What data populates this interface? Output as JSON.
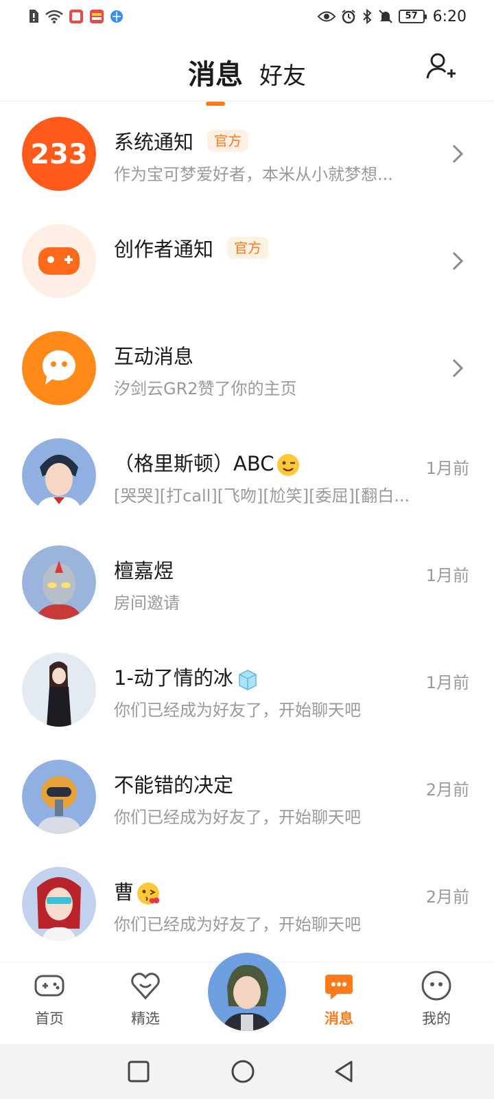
{
  "status_bar": {
    "time": "6:20",
    "battery": "57"
  },
  "header": {
    "tab_messages": "消息",
    "tab_friends": "好友"
  },
  "messages": [
    {
      "name": "系统通知",
      "badge": "官方",
      "preview": "作为宝可梦爱好者，本米从小就梦想...",
      "avatar": "233-logo"
    },
    {
      "name": "创作者通知",
      "badge": "官方",
      "preview": "",
      "avatar": "gamepad-avatar"
    },
    {
      "name": "互动消息",
      "preview": "汐剑云GR2赞了你的主页",
      "avatar": "chat-bubble-avatar"
    },
    {
      "name": "（格里斯顿）ABC",
      "time": "1月前",
      "preview": "[哭哭][打call][飞吻][尬笑][委屈][翻白...",
      "avatar": "user-avatar"
    },
    {
      "name": "檀嘉煜",
      "time": "1月前",
      "preview": "房间邀请",
      "avatar": "user-avatar"
    },
    {
      "name": "1-动了情的冰",
      "time": "1月前",
      "preview": "你们已经成为好友了，开始聊天吧",
      "avatar": "user-avatar"
    },
    {
      "name": "不能错的决定",
      "time": "2月前",
      "preview": "你们已经成为好友了，开始聊天吧",
      "avatar": "user-avatar"
    },
    {
      "name": "曹",
      "time": "2月前",
      "preview": "你们已经成为好友了，开始聊天吧",
      "avatar": "user-avatar"
    }
  ],
  "logo_text": "233",
  "bottom_nav": {
    "home": "首页",
    "featured": "精选",
    "messages": "消息",
    "mine": "我的"
  },
  "colors": {
    "accent": "#ff7a1a",
    "muted": "#9a9a9a"
  }
}
